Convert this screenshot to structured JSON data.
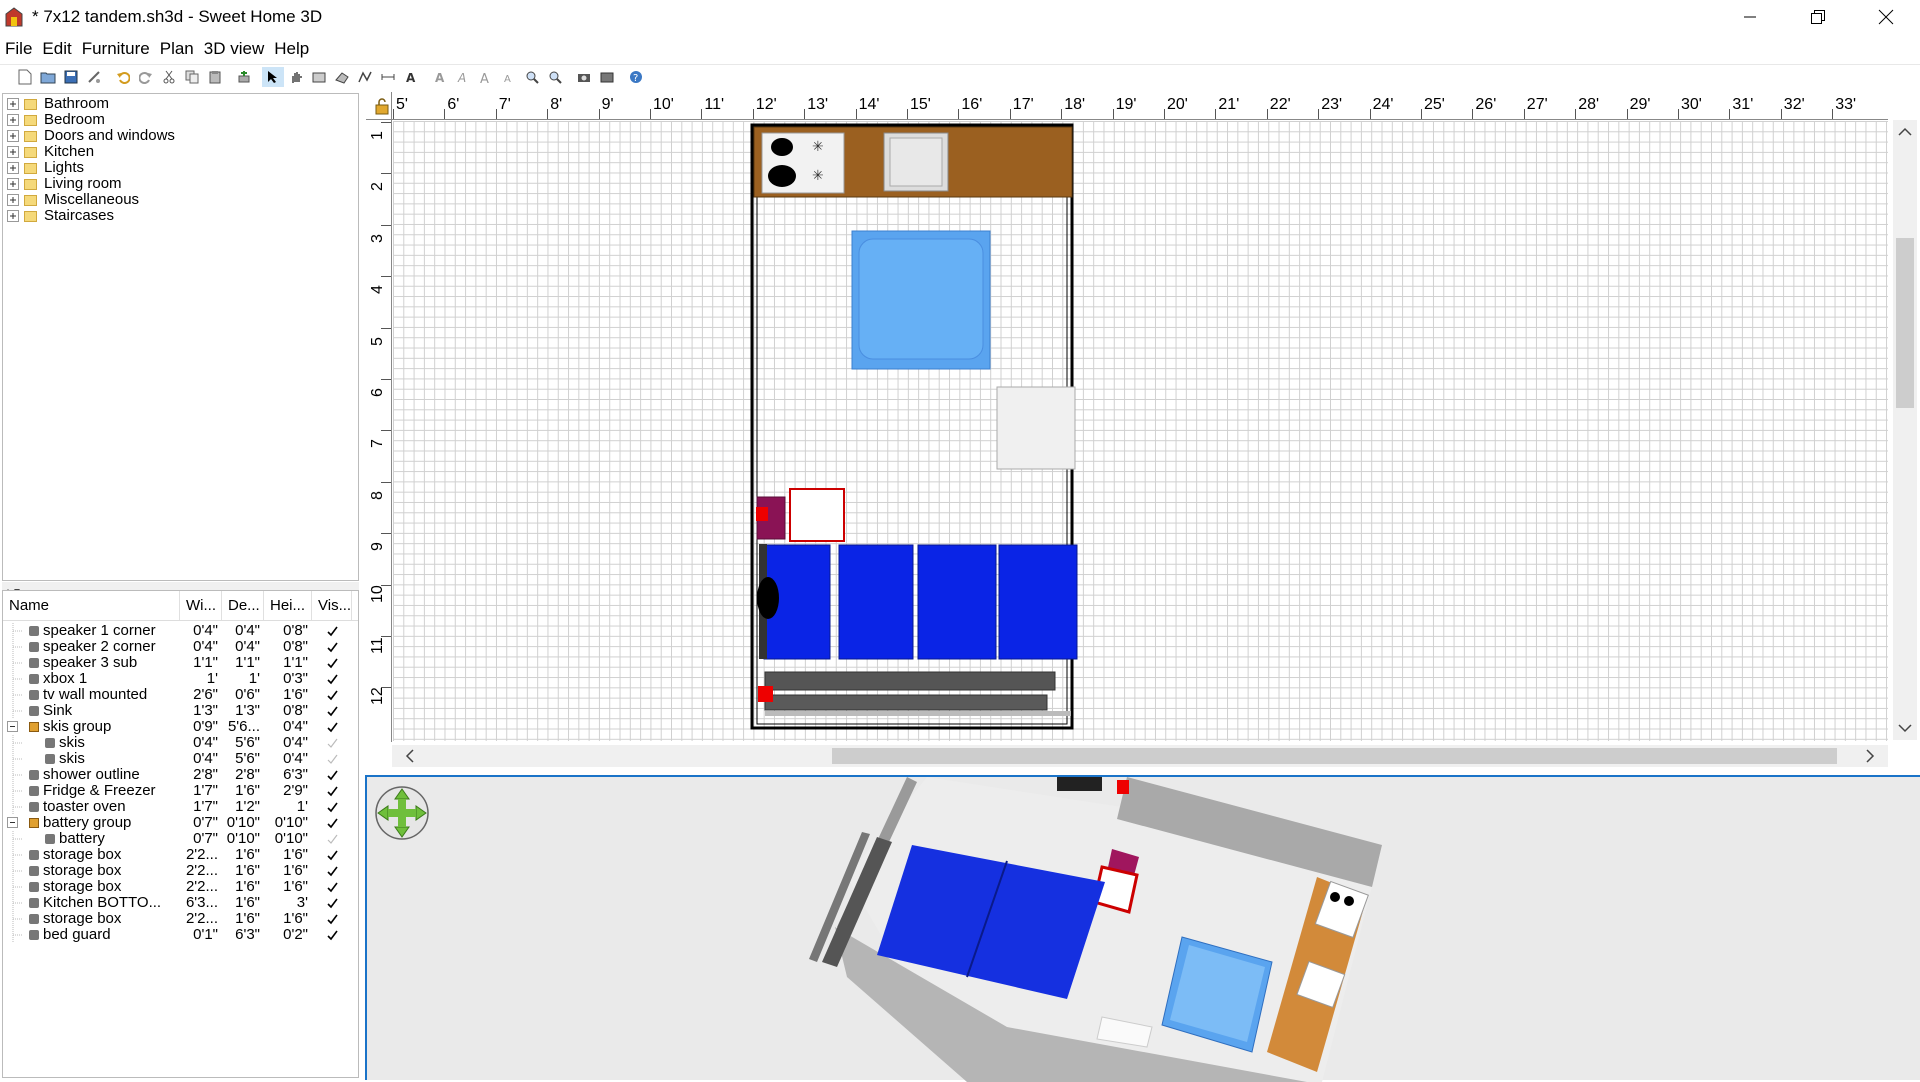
{
  "window": {
    "title": "* 7x12 tandem.sh3d - Sweet Home 3D"
  },
  "menu": [
    "File",
    "Edit",
    "Furniture",
    "Plan",
    "3D view",
    "Help"
  ],
  "catalog": {
    "categories": [
      "Bathroom",
      "Bedroom",
      "Doors and windows",
      "Kitchen",
      "Lights",
      "Living room",
      "Miscellaneous",
      "Staircases"
    ]
  },
  "furniture_list": {
    "headers": {
      "name": "Name",
      "width": "Wi...",
      "depth": "De...",
      "height": "Hei...",
      "visible": "Vis..."
    },
    "rows": [
      {
        "name": "speaker 1 corner",
        "w": "0'4\"",
        "d": "0'4\"",
        "h": "0'8\"",
        "visible": true,
        "level": 0,
        "group": false
      },
      {
        "name": "speaker 2 corner",
        "w": "0'4\"",
        "d": "0'4\"",
        "h": "0'8\"",
        "visible": true,
        "level": 0,
        "group": false
      },
      {
        "name": "speaker 3 sub",
        "w": "1'1\"",
        "d": "1'1\"",
        "h": "1'1\"",
        "visible": true,
        "level": 0,
        "group": false
      },
      {
        "name": "xbox 1",
        "w": "1'",
        "d": "1'",
        "h": "0'3\"",
        "visible": true,
        "level": 0,
        "group": false
      },
      {
        "name": "tv wall mounted",
        "w": "2'6\"",
        "d": "0'6\"",
        "h": "1'6\"",
        "visible": true,
        "level": 0,
        "group": false
      },
      {
        "name": "Sink",
        "w": "1'3\"",
        "d": "1'3\"",
        "h": "0'8\"",
        "visible": true,
        "level": 0,
        "group": false
      },
      {
        "name": "skis group",
        "w": "0'9\"",
        "d": "5'6...",
        "h": "0'4\"",
        "visible": true,
        "level": 0,
        "group": true
      },
      {
        "name": "skis",
        "w": "0'4\"",
        "d": "5'6\"",
        "h": "0'4\"",
        "visible": false,
        "level": 1,
        "group": false
      },
      {
        "name": "skis",
        "w": "0'4\"",
        "d": "5'6\"",
        "h": "0'4\"",
        "visible": false,
        "level": 1,
        "group": false
      },
      {
        "name": "shower outline",
        "w": "2'8\"",
        "d": "2'8\"",
        "h": "6'3\"",
        "visible": true,
        "level": 0,
        "group": false
      },
      {
        "name": "Fridge & Freezer",
        "w": "1'7\"",
        "d": "1'6\"",
        "h": "2'9\"",
        "visible": true,
        "level": 0,
        "group": false
      },
      {
        "name": "toaster oven",
        "w": "1'7\"",
        "d": "1'2\"",
        "h": "1'",
        "visible": true,
        "level": 0,
        "group": false
      },
      {
        "name": "battery group",
        "w": "0'7\"",
        "d": "0'10\"",
        "h": "0'10\"",
        "visible": true,
        "level": 0,
        "group": true
      },
      {
        "name": "battery",
        "w": "0'7\"",
        "d": "0'10\"",
        "h": "0'10\"",
        "visible": false,
        "level": 1,
        "group": false
      },
      {
        "name": "storage box",
        "w": "2'2...",
        "d": "1'6\"",
        "h": "1'6\"",
        "visible": true,
        "level": 0,
        "group": false
      },
      {
        "name": "storage box",
        "w": "2'2...",
        "d": "1'6\"",
        "h": "1'6\"",
        "visible": true,
        "level": 0,
        "group": false
      },
      {
        "name": "storage box",
        "w": "2'2...",
        "d": "1'6\"",
        "h": "1'6\"",
        "visible": true,
        "level": 0,
        "group": false
      },
      {
        "name": "Kitchen BOTTO...",
        "w": "6'3...",
        "d": "1'6\"",
        "h": "3'",
        "visible": true,
        "level": 0,
        "group": false
      },
      {
        "name": "storage box",
        "w": "2'2...",
        "d": "1'6\"",
        "h": "1'6\"",
        "visible": true,
        "level": 0,
        "group": false
      },
      {
        "name": "bed guard",
        "w": "0'1\"",
        "d": "6'3\"",
        "h": "0'2\"",
        "visible": true,
        "level": 0,
        "group": false
      }
    ]
  },
  "plan": {
    "ruler_x": [
      "5'",
      "6'",
      "7'",
      "8'",
      "9'",
      "10'",
      "11'",
      "12'",
      "13'",
      "14'",
      "15'",
      "16'",
      "17'",
      "18'",
      "19'",
      "20'",
      "21'",
      "22'",
      "23'",
      "24'",
      "25'",
      "26'",
      "27'",
      "28'",
      "29'",
      "30'",
      "31'",
      "32'",
      "33'"
    ],
    "ruler_y": [
      "1",
      "2",
      "3",
      "4",
      "5",
      "6",
      "7",
      "8",
      "9",
      "10",
      "11",
      "12"
    ]
  },
  "colors": {
    "wall": "#000000",
    "kitchen_counter": "#9b6020",
    "shower": "#5aa4ef",
    "storage_box": "#0a24e6",
    "tv": "#8a1355",
    "accent_red": "#ee0000",
    "selection": "#1a73c8"
  }
}
